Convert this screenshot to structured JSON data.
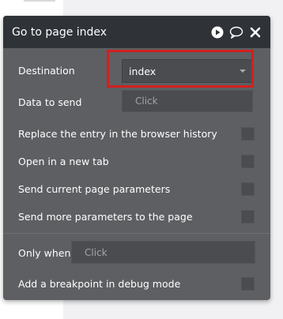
{
  "dialog": {
    "title": "Go to page index",
    "icons": [
      "play-icon",
      "comment-icon",
      "close-icon"
    ]
  },
  "fields": {
    "destination_label": "Destination",
    "destination_value": "index",
    "data_to_send_label": "Data to send",
    "data_to_send_placeholder": "Click",
    "replace_history_label": "Replace the entry in the browser history",
    "open_new_tab_label": "Open in a new tab",
    "send_current_params_label": "Send current page parameters",
    "send_more_params_label": "Send more parameters to the page",
    "only_when_label": "Only when",
    "only_when_placeholder": "Click",
    "breakpoint_label": "Add a breakpoint in debug mode"
  },
  "colors": {
    "header_bg": "#2f3338",
    "panel_bg": "#5d5f62",
    "highlight": "#d21f1f"
  }
}
